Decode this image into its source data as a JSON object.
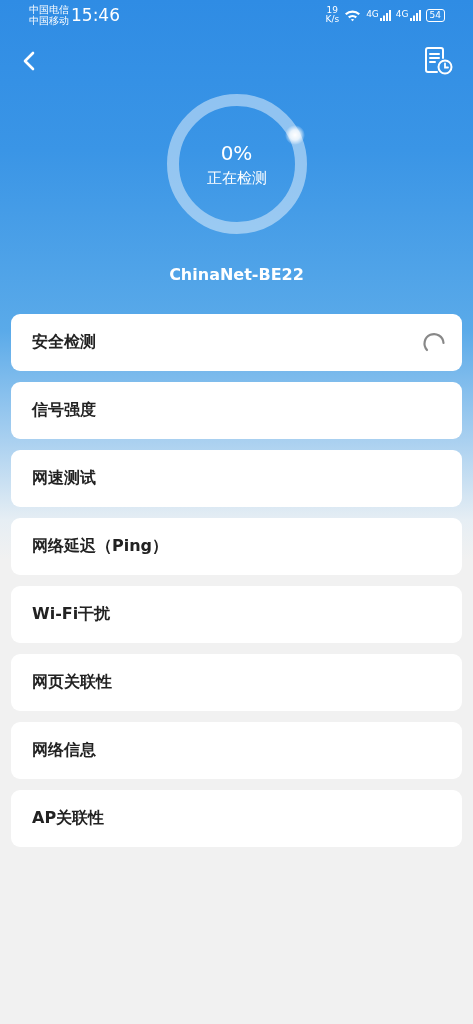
{
  "status_bar": {
    "carriers": [
      "中国电信",
      "中国移动"
    ],
    "time": "15:46",
    "speed": "19",
    "speed_unit": "K/s",
    "network_labels": [
      "4G",
      "4G"
    ],
    "battery": "54"
  },
  "header": {
    "percent": "0%",
    "status": "正在检测",
    "network_name": "ChinaNet-BE22"
  },
  "checks": [
    {
      "label": "安全检测",
      "running": true
    },
    {
      "label": "信号强度",
      "running": false
    },
    {
      "label": "网速测试",
      "running": false
    },
    {
      "label": "网络延迟（Ping）",
      "running": false
    },
    {
      "label": "Wi-Fi干扰",
      "running": false
    },
    {
      "label": "网页关联性",
      "running": false
    },
    {
      "label": "网络信息",
      "running": false
    },
    {
      "label": "AP关联性",
      "running": false
    }
  ]
}
